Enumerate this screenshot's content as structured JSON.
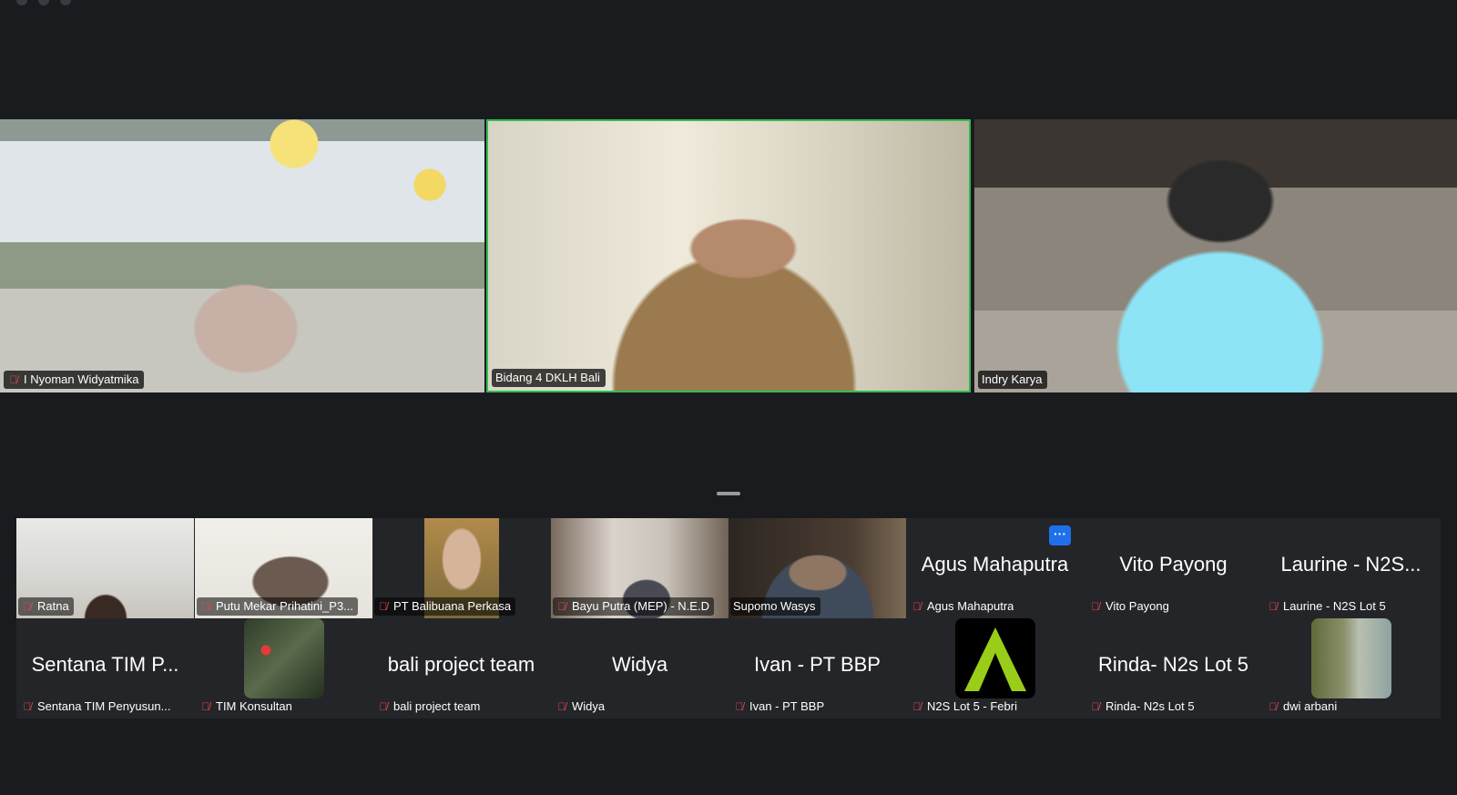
{
  "speakers": [
    {
      "name": "I Nyoman Widyatmika",
      "muted": true
    },
    {
      "name": "Bidang 4 DKLH Bali",
      "muted": false,
      "active_speaker": true
    },
    {
      "name": "Indry Karya",
      "muted": false
    }
  ],
  "gallery_row1": [
    {
      "label": "Ratna",
      "video": true
    },
    {
      "label": "Putu Mekar Prihatini_P3...",
      "video": true
    },
    {
      "label": "PT Balibuana Perkasa",
      "video": true
    },
    {
      "label": "Bayu Putra (MEP) - N.E.D",
      "video": true
    },
    {
      "label": "Supomo Wasys",
      "video": true
    },
    {
      "display": "Agus Mahaputra",
      "label": "Agus Mahaputra",
      "more_icon": "more-horizontal-icon"
    },
    {
      "display": "Vito Payong",
      "label": "Vito Payong"
    },
    {
      "display": "Laurine - N2S...",
      "label": "Laurine - N2S Lot 5"
    }
  ],
  "gallery_row2": [
    {
      "display": "Sentana TIM P...",
      "label": "Sentana TIM Penyusun..."
    },
    {
      "label": "TIM Konsultan",
      "avatar": "map-avatar"
    },
    {
      "display": "bali project team",
      "label": "bali project team"
    },
    {
      "display": "Widya",
      "label": "Widya"
    },
    {
      "display": "Ivan - PT BBP",
      "label": "Ivan - PT BBP"
    },
    {
      "label": "N2S Lot 5 - Febri",
      "avatar": "logo-avatar"
    },
    {
      "display": "Rinda- N2s Lot 5",
      "label": "Rinda- N2s Lot 5"
    },
    {
      "label": "dwi arbani",
      "avatar": "landscape-avatar"
    }
  ],
  "colors": {
    "background": "#1a1b1f",
    "active_speaker_border": "#2fbf4c",
    "muted_icon": "#e5484d",
    "more_button": "#1f6feb"
  },
  "icons": {
    "muted": "mic-off-icon",
    "more": "more-horizontal-icon"
  }
}
